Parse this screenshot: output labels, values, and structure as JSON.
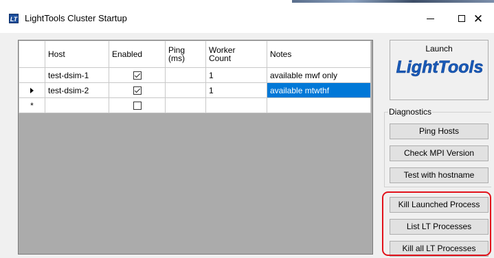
{
  "window": {
    "title": "LightTools Cluster Startup",
    "app_icon_text": "LT",
    "minimize_glyph": "—",
    "close_glyph": "✕"
  },
  "grid": {
    "columns": [
      "Host",
      "Enabled",
      "Ping\n(ms)",
      "Worker\nCount",
      "Notes"
    ],
    "column_lines": [
      [
        "Host"
      ],
      [
        "Enabled"
      ],
      [
        "Ping",
        "(ms)"
      ],
      [
        "Worker",
        "Count"
      ],
      [
        "Notes"
      ]
    ],
    "rows": [
      {
        "indicator": "",
        "host": "test-dsim-1",
        "enabled": true,
        "ping": "",
        "worker_count": "1",
        "notes": "available mwf only",
        "selected_notes": false
      },
      {
        "indicator": "current",
        "host": "test-dsim-2",
        "enabled": true,
        "ping": "",
        "worker_count": "1",
        "notes": "available mtwthf",
        "selected_notes": true
      },
      {
        "indicator": "new",
        "host": "",
        "enabled": false,
        "ping": "",
        "worker_count": "",
        "notes": "",
        "selected_notes": false
      }
    ],
    "new_row_glyph": "*"
  },
  "launch": {
    "label": "Launch",
    "logo_text": "LightTools"
  },
  "diagnostics": {
    "legend": "Diagnostics",
    "ping_hosts": "Ping Hosts",
    "check_mpi": "Check MPI Version",
    "test_hostname": "Test with hostname"
  },
  "process_buttons": {
    "kill_launched": "Kill Launched Process",
    "list_lt": "List LT Processes",
    "kill_all_lt": "Kill all LT Processes"
  },
  "colors": {
    "selection": "#0078d7",
    "highlight_box": "#e2121b",
    "logo_blue": "#1a5bb8"
  }
}
